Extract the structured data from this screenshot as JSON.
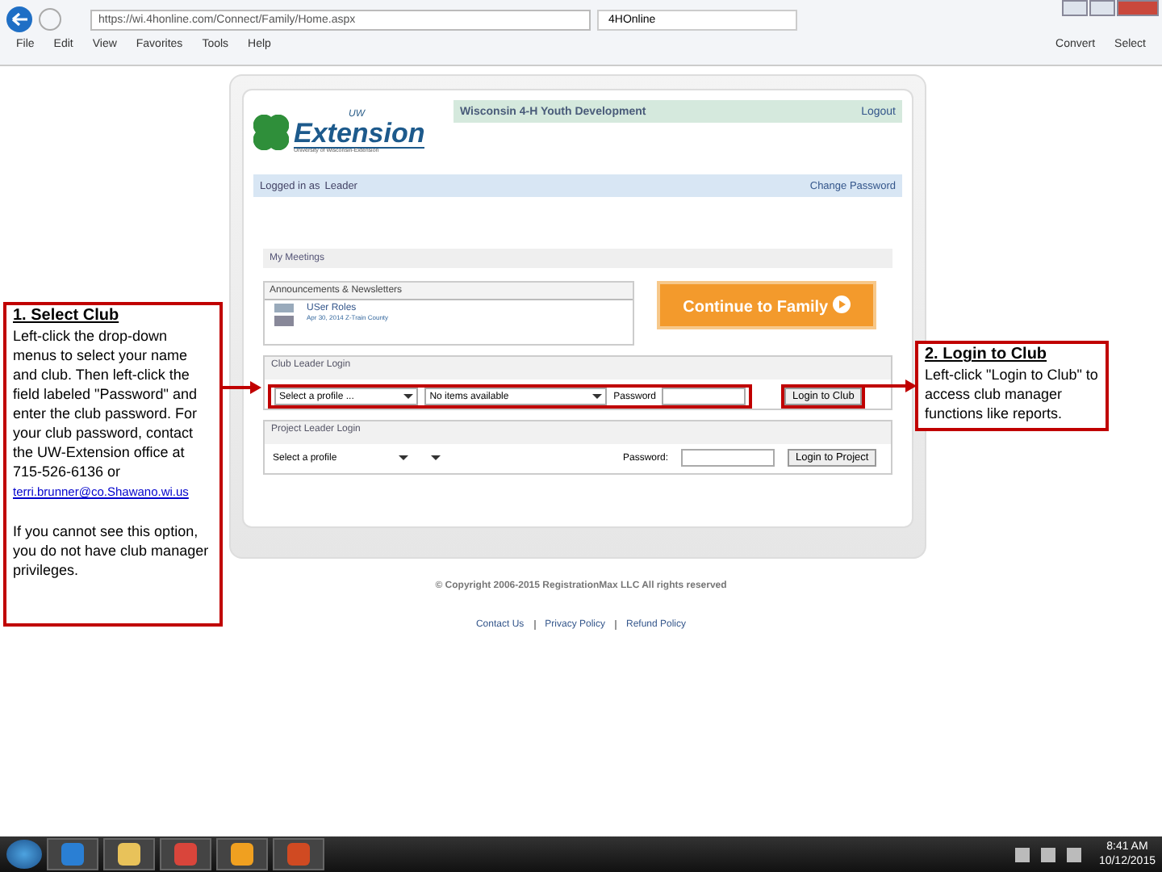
{
  "browser": {
    "url": "https://wi.4honline.com/Connect/Family/Home.aspx",
    "tab_title": "4HOnline",
    "menu": [
      "File",
      "Edit",
      "View",
      "Favorites",
      "Tools",
      "Help"
    ],
    "toolbar": [
      "Convert",
      "Select"
    ]
  },
  "page": {
    "logo": {
      "top": "UW",
      "main": "Extension",
      "sub": "University of Wisconsin-Extension"
    },
    "header_title": "Wisconsin 4-H Youth Development",
    "logout": "Logout",
    "logged_in_label": "Logged in as",
    "user": "Leader",
    "change_password": "Change Password",
    "meetings_title": "My Meetings",
    "announcements": {
      "title": "Announcements & Newsletters",
      "items": [
        {
          "title": "USer Roles",
          "date": "Apr 30, 2014 Z-Train County"
        }
      ]
    },
    "continue_button": "Continue to Family",
    "club_login": {
      "title": "Club Leader Login",
      "profile": "Select a profile ...",
      "club": "No items available",
      "password_label": "Password",
      "button": "Login to Club"
    },
    "project_login": {
      "title": "Project Leader Login",
      "profile": "Select a profile",
      "password_label": "Password:",
      "button": "Login to Project"
    },
    "copyright": "© Copyright 2006-2015 RegistrationMax LLC All rights reserved",
    "footer_links": [
      "Contact Us",
      "Privacy Policy",
      "Refund Policy"
    ]
  },
  "annotations": [
    {
      "title": "1. Select Club",
      "body": "Left-click the drop-down menus to select your name and club. Then left-click the field labeled \"Password\" and enter the club password. For your club password, contact the UW-Extension office at 715-526-6136 or",
      "link": "terri.brunner@co.Shawano.wi.us",
      "note": "If you cannot see this option, you do not have club manager privileges."
    },
    {
      "title": "2. Login to Club",
      "body": "Left-click \"Login to Club\" to access club manager functions like reports."
    }
  ],
  "taskbar": {
    "apps": [
      {
        "kind": "ie"
      },
      {
        "kind": "folder"
      },
      {
        "kind": "chrome"
      },
      {
        "kind": "outlook"
      },
      {
        "kind": "powerpoint"
      }
    ],
    "time": "8:41 AM",
    "date": "10/12/2015"
  }
}
